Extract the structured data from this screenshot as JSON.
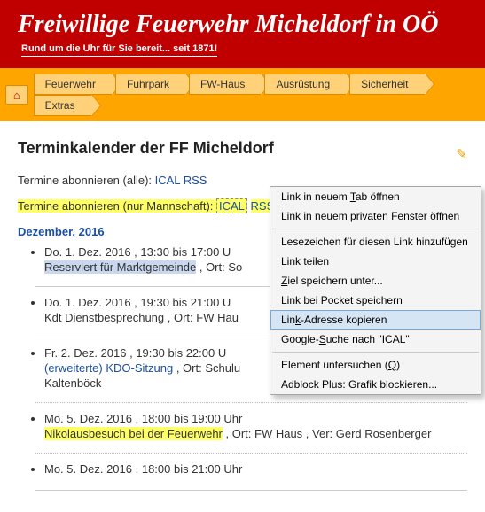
{
  "header": {
    "title": "Freiwillige Feuerwehr Micheldorf in OÖ",
    "tagline": "Rund um die Uhr für Sie bereit... seit 1871!"
  },
  "nav": {
    "items": [
      "Feuerwehr",
      "Fuhrpark",
      "FW-Haus",
      "Ausrüstung",
      "Sicherheit",
      "Extras"
    ]
  },
  "page": {
    "title": "Terminkalender der FF Micheldorf",
    "sub_all_label": "Termine abonnieren (alle): ",
    "sub_team_label": "Termine abonnieren (nur Mannschaft): ",
    "ical": "ICAL",
    "rss": "RSS",
    "month": "Dezember, 2016"
  },
  "events": [
    {
      "dt": "Do. 1. Dez. 2016 , 13:30 bis 17:00 U",
      "title": "Reserviert für Marktgemeinde",
      "suffix": " , Ort: So",
      "title_class": "sel"
    },
    {
      "dt": "Do. 1. Dez. 2016 , 19:30 bis 21:00 U",
      "title": "Kdt Dienstbesprechung",
      "suffix": " , Ort: FW Hau",
      "title_class": ""
    },
    {
      "dt": "Fr. 2. Dez. 2016 , 19:30 bis 22:00 U",
      "title": "(erweiterte) KDO-Sitzung",
      "suffix": " , Ort: Schulu",
      "extra": "Kaltenböck",
      "title_class": "link"
    },
    {
      "dt": "Mo. 5. Dez. 2016 , 18:00 bis 19:00 Uhr",
      "title": "Nikolausbesuch bei der Feuerwehr",
      "suffix": " , Ort: FW Haus , Ver: Gerd Rosenberger",
      "title_class": "y"
    },
    {
      "dt": "Mo. 5. Dez. 2016 , 18:00 bis 21:00 Uhr",
      "title": "",
      "suffix": "",
      "title_class": ""
    }
  ],
  "ctx": {
    "items": [
      {
        "label": "Link in neuem Tab öffnen",
        "u": "T"
      },
      {
        "label": "Link in neuem privaten Fenster öffnen",
        "u": ""
      },
      {
        "sep": true
      },
      {
        "label": "Lesezeichen für diesen Link hinzufügen",
        "u": ""
      },
      {
        "label": "Link teilen",
        "u": ""
      },
      {
        "label": "Ziel speichern unter...",
        "u": "Z"
      },
      {
        "label": "Link bei Pocket speichern",
        "u": ""
      },
      {
        "label": "Link-Adresse kopieren",
        "u": "k",
        "hover": true
      },
      {
        "label": "Google-Suche nach \"ICAL\"",
        "u": "S"
      },
      {
        "sep": true
      },
      {
        "label": "Element untersuchen (Q)",
        "u": "",
        "paren_u": "Q"
      },
      {
        "label": "Adblock Plus: Grafik blockieren...",
        "u": ""
      }
    ]
  }
}
